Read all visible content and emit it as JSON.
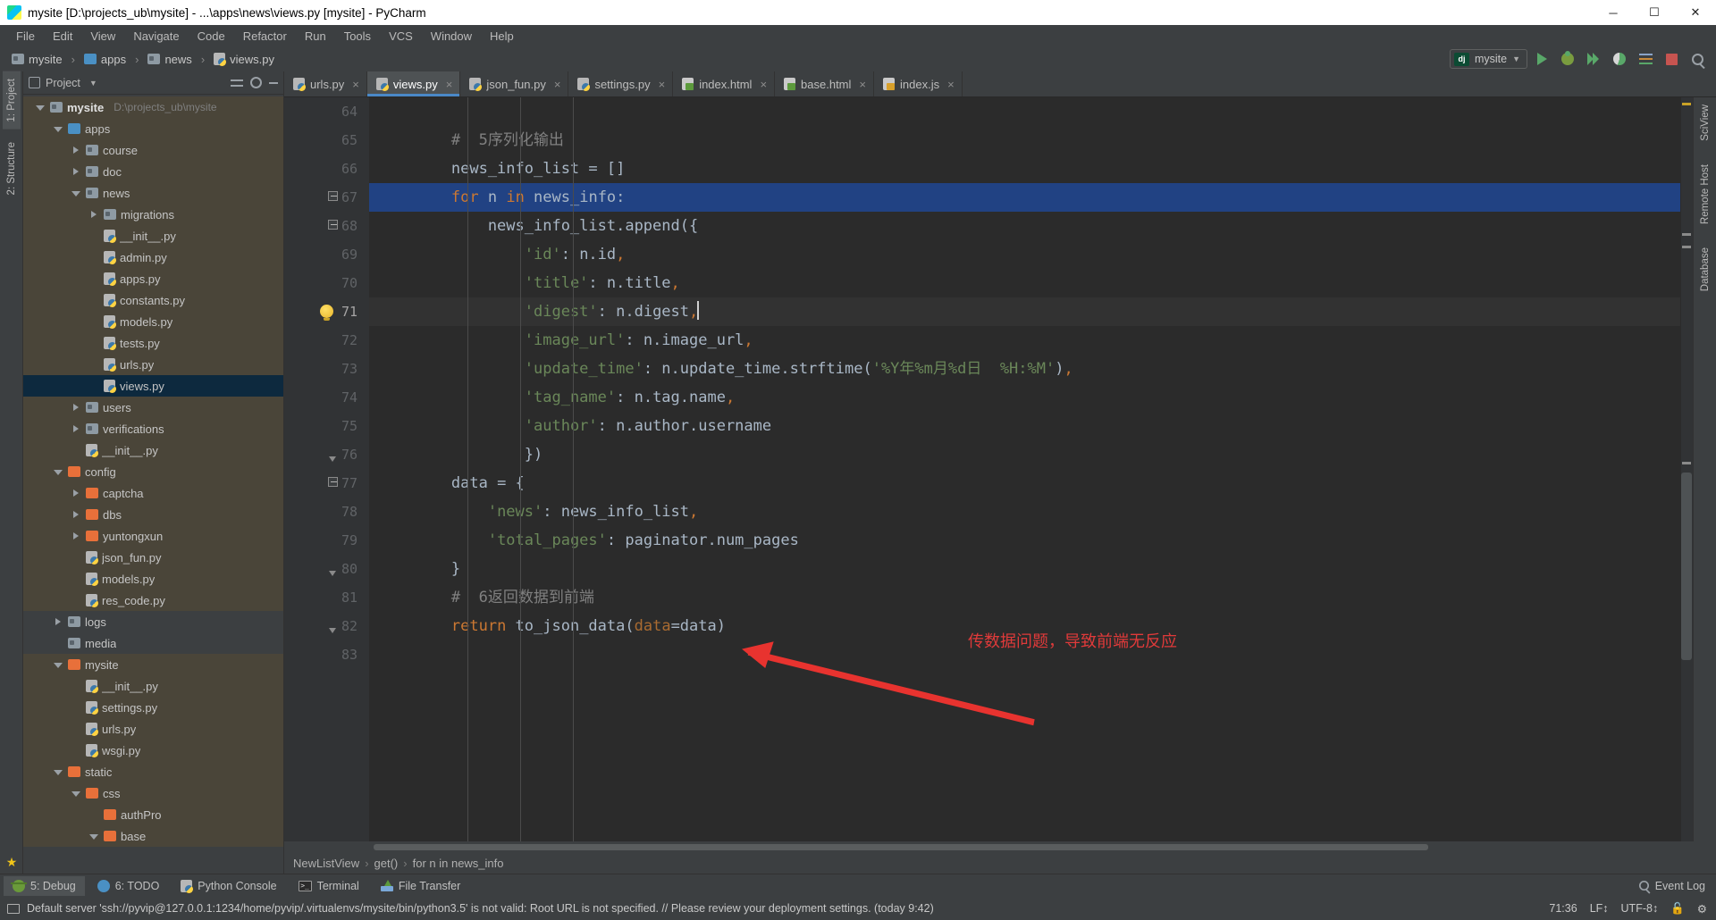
{
  "window": {
    "title": "mysite [D:\\projects_ub\\mysite] - ...\\apps\\news\\views.py [mysite] - PyCharm",
    "logo_text": "PC",
    "minimize": "─",
    "maximize": "☐",
    "close": "✕"
  },
  "menubar": {
    "items": [
      "File",
      "Edit",
      "View",
      "Navigate",
      "Code",
      "Refactor",
      "Run",
      "Tools",
      "VCS",
      "Window",
      "Help"
    ]
  },
  "navbar": {
    "breadcrumbs": [
      {
        "label": "mysite",
        "icon": "folder-icon"
      },
      {
        "label": "apps",
        "icon": "folder-blue-icon"
      },
      {
        "label": "news",
        "icon": "folder-icon"
      },
      {
        "label": "views.py",
        "icon": "python-file-icon"
      }
    ],
    "run_config": "mysite",
    "run_config_badge": "dj",
    "buttons": [
      {
        "name": "run-button",
        "title": "Run"
      },
      {
        "name": "debug-button",
        "title": "Debug"
      },
      {
        "name": "run-with-coverage-button",
        "title": "Run with Coverage"
      },
      {
        "name": "profile-button",
        "title": "Profile"
      },
      {
        "name": "attach-button",
        "title": "Attach"
      },
      {
        "name": "stop-button",
        "title": "Stop"
      },
      {
        "name": "search-everywhere-button",
        "title": "Search Everywhere"
      }
    ]
  },
  "left_rail": {
    "tabs": [
      "1: Project",
      "2: Structure"
    ],
    "active": "1: Project",
    "favorites": "2: Favorites"
  },
  "right_rail": {
    "tabs": [
      "SciView",
      "Remote Host",
      "Database"
    ]
  },
  "project_pane": {
    "title": "Project",
    "tree": [
      {
        "depth": 0,
        "label": "mysite",
        "path": "D:\\projects_ub\\mysite",
        "arrow": "open",
        "icon": "folder-icon",
        "bold": true,
        "style": "module"
      },
      {
        "depth": 1,
        "label": "apps",
        "arrow": "open",
        "icon": "folder-blue-icon",
        "style": "module"
      },
      {
        "depth": 2,
        "label": "course",
        "arrow": "closed",
        "icon": "folder-icon",
        "style": "module"
      },
      {
        "depth": 2,
        "label": "doc",
        "arrow": "closed",
        "icon": "folder-icon",
        "style": "module"
      },
      {
        "depth": 2,
        "label": "news",
        "arrow": "open",
        "icon": "folder-icon",
        "style": "module"
      },
      {
        "depth": 3,
        "label": "migrations",
        "arrow": "closed",
        "icon": "folder-icon",
        "style": "module"
      },
      {
        "depth": 3,
        "label": "__init__.py",
        "arrow": "none",
        "icon": "python-file-icon",
        "style": "module"
      },
      {
        "depth": 3,
        "label": "admin.py",
        "arrow": "none",
        "icon": "python-file-icon",
        "style": "module"
      },
      {
        "depth": 3,
        "label": "apps.py",
        "arrow": "none",
        "icon": "python-file-icon",
        "style": "module"
      },
      {
        "depth": 3,
        "label": "constants.py",
        "arrow": "none",
        "icon": "python-file-icon",
        "style": "module"
      },
      {
        "depth": 3,
        "label": "models.py",
        "arrow": "none",
        "icon": "python-file-icon",
        "style": "module"
      },
      {
        "depth": 3,
        "label": "tests.py",
        "arrow": "none",
        "icon": "python-file-icon",
        "style": "module"
      },
      {
        "depth": 3,
        "label": "urls.py",
        "arrow": "none",
        "icon": "python-file-icon",
        "style": "module"
      },
      {
        "depth": 3,
        "label": "views.py",
        "arrow": "none",
        "icon": "python-file-icon",
        "selected": true
      },
      {
        "depth": 2,
        "label": "users",
        "arrow": "closed",
        "icon": "folder-icon",
        "style": "module"
      },
      {
        "depth": 2,
        "label": "verifications",
        "arrow": "closed",
        "icon": "folder-icon",
        "style": "module"
      },
      {
        "depth": 2,
        "label": "__init__.py",
        "arrow": "none",
        "icon": "python-file-icon",
        "style": "module"
      },
      {
        "depth": 1,
        "label": "config",
        "arrow": "open",
        "icon": "folder-orange-icon",
        "style": "module"
      },
      {
        "depth": 2,
        "label": "captcha",
        "arrow": "closed",
        "icon": "folder-orange-icon",
        "style": "module"
      },
      {
        "depth": 2,
        "label": "dbs",
        "arrow": "closed",
        "icon": "folder-orange-icon",
        "style": "module"
      },
      {
        "depth": 2,
        "label": "yuntongxun",
        "arrow": "closed",
        "icon": "folder-orange-icon",
        "style": "module"
      },
      {
        "depth": 2,
        "label": "json_fun.py",
        "arrow": "none",
        "icon": "python-file-icon",
        "style": "module"
      },
      {
        "depth": 2,
        "label": "models.py",
        "arrow": "none",
        "icon": "python-file-icon",
        "style": "module"
      },
      {
        "depth": 2,
        "label": "res_code.py",
        "arrow": "none",
        "icon": "python-file-icon",
        "style": "module"
      },
      {
        "depth": 1,
        "label": "logs",
        "arrow": "closed",
        "icon": "folder-icon"
      },
      {
        "depth": 1,
        "label": "media",
        "arrow": "none",
        "icon": "folder-icon"
      },
      {
        "depth": 1,
        "label": "mysite",
        "arrow": "open",
        "icon": "folder-orange-icon",
        "style": "module"
      },
      {
        "depth": 2,
        "label": "__init__.py",
        "arrow": "none",
        "icon": "python-file-icon",
        "style": "module"
      },
      {
        "depth": 2,
        "label": "settings.py",
        "arrow": "none",
        "icon": "python-file-icon",
        "style": "module"
      },
      {
        "depth": 2,
        "label": "urls.py",
        "arrow": "none",
        "icon": "python-file-icon",
        "style": "module"
      },
      {
        "depth": 2,
        "label": "wsgi.py",
        "arrow": "none",
        "icon": "python-file-icon",
        "style": "module"
      },
      {
        "depth": 1,
        "label": "static",
        "arrow": "open",
        "icon": "folder-orange-icon",
        "style": "module"
      },
      {
        "depth": 2,
        "label": "css",
        "arrow": "open",
        "icon": "folder-orange-icon",
        "style": "module"
      },
      {
        "depth": 3,
        "label": "authPro",
        "arrow": "none",
        "icon": "folder-orange-icon",
        "style": "module"
      },
      {
        "depth": 3,
        "label": "base",
        "arrow": "open",
        "icon": "folder-orange-icon",
        "style": "module"
      }
    ]
  },
  "editor_tabs": [
    {
      "label": "urls.py",
      "icon": "python-file-icon",
      "active": false
    },
    {
      "label": "views.py",
      "icon": "python-file-icon",
      "active": true
    },
    {
      "label": "json_fun.py",
      "icon": "python-file-icon",
      "active": false
    },
    {
      "label": "settings.py",
      "icon": "python-file-icon",
      "active": false
    },
    {
      "label": "index.html",
      "icon": "html-file-icon",
      "active": false
    },
    {
      "label": "base.html",
      "icon": "html-file-icon",
      "active": false
    },
    {
      "label": "index.js",
      "icon": "js-file-icon",
      "active": false
    }
  ],
  "editor": {
    "first_line": 64,
    "lines": [
      {
        "n": 64,
        "tokens": []
      },
      {
        "n": 65,
        "tokens": [
          {
            "t": "        ",
            "c": "pun"
          },
          {
            "t": "#  5序列化输出",
            "c": "cmt"
          }
        ]
      },
      {
        "n": 66,
        "tokens": [
          {
            "t": "        news_info_list ",
            "c": "pun"
          },
          {
            "t": "= ",
            "c": "pun"
          },
          {
            "t": "[]",
            "c": "pun"
          }
        ]
      },
      {
        "n": 67,
        "highlight": true,
        "tokens": [
          {
            "t": "        ",
            "c": "pun"
          },
          {
            "t": "for ",
            "c": "kw"
          },
          {
            "t": "n ",
            "c": "pun"
          },
          {
            "t": "in ",
            "c": "kw"
          },
          {
            "t": "news_info:",
            "c": "pun"
          }
        ]
      },
      {
        "n": 68,
        "tokens": [
          {
            "t": "            news_info_list.append({",
            "c": "pun"
          }
        ]
      },
      {
        "n": 69,
        "tokens": [
          {
            "t": "                ",
            "c": "pun"
          },
          {
            "t": "'id'",
            "c": "str"
          },
          {
            "t": ": n.id",
            "c": "pun"
          },
          {
            "t": ",",
            "c": "comma"
          }
        ]
      },
      {
        "n": 70,
        "tokens": [
          {
            "t": "                ",
            "c": "pun"
          },
          {
            "t": "'title'",
            "c": "str"
          },
          {
            "t": ": n.title",
            "c": "pun"
          },
          {
            "t": ",",
            "c": "comma"
          }
        ]
      },
      {
        "n": 71,
        "caretline": true,
        "bulb": true,
        "caret": true,
        "tokens": [
          {
            "t": "                ",
            "c": "pun"
          },
          {
            "t": "'digest'",
            "c": "str"
          },
          {
            "t": ": n.digest",
            "c": "pun"
          },
          {
            "t": ",",
            "c": "comma"
          }
        ]
      },
      {
        "n": 72,
        "tokens": [
          {
            "t": "                ",
            "c": "pun"
          },
          {
            "t": "'image_url'",
            "c": "str"
          },
          {
            "t": ": n.image_url",
            "c": "pun"
          },
          {
            "t": ",",
            "c": "comma"
          }
        ]
      },
      {
        "n": 73,
        "tokens": [
          {
            "t": "                ",
            "c": "pun"
          },
          {
            "t": "'update_time'",
            "c": "str"
          },
          {
            "t": ": n.update_time.strftime(",
            "c": "pun"
          },
          {
            "t": "'%Y年%m月%d日  %H:%M'",
            "c": "str"
          },
          {
            "t": ")",
            "c": "pun"
          },
          {
            "t": ",",
            "c": "comma"
          }
        ]
      },
      {
        "n": 74,
        "tokens": [
          {
            "t": "                ",
            "c": "pun"
          },
          {
            "t": "'tag_name'",
            "c": "str"
          },
          {
            "t": ": n.tag.name",
            "c": "pun"
          },
          {
            "t": ",",
            "c": "comma"
          }
        ]
      },
      {
        "n": 75,
        "tokens": [
          {
            "t": "                ",
            "c": "pun"
          },
          {
            "t": "'author'",
            "c": "str"
          },
          {
            "t": ": n.author.username",
            "c": "pun"
          }
        ]
      },
      {
        "n": 76,
        "tokens": [
          {
            "t": "                })",
            "c": "pun"
          }
        ]
      },
      {
        "n": 77,
        "tokens": [
          {
            "t": "        data ",
            "c": "pun"
          },
          {
            "t": "= {",
            "c": "pun"
          }
        ]
      },
      {
        "n": 78,
        "tokens": [
          {
            "t": "            ",
            "c": "pun"
          },
          {
            "t": "'news'",
            "c": "str"
          },
          {
            "t": ": news_info_list",
            "c": "pun"
          },
          {
            "t": ",",
            "c": "comma"
          }
        ]
      },
      {
        "n": 79,
        "tokens": [
          {
            "t": "            ",
            "c": "pun"
          },
          {
            "t": "'total_pages'",
            "c": "str"
          },
          {
            "t": ": paginator.num_pages",
            "c": "pun"
          }
        ]
      },
      {
        "n": 80,
        "tokens": [
          {
            "t": "        }",
            "c": "pun"
          }
        ]
      },
      {
        "n": 81,
        "tokens": [
          {
            "t": "        ",
            "c": "pun"
          },
          {
            "t": "#  6返回数据到前端",
            "c": "cmt"
          }
        ]
      },
      {
        "n": 82,
        "tokens": [
          {
            "t": "        ",
            "c": "pun"
          },
          {
            "t": "return ",
            "c": "kw"
          },
          {
            "t": "to_json_data(",
            "c": "pun"
          },
          {
            "t": "data",
            "c": "param"
          },
          {
            "t": "=data)",
            "c": "pun"
          }
        ]
      },
      {
        "n": 83,
        "tokens": []
      }
    ]
  },
  "annotation": {
    "text": "传数据问题，导致前端无反应",
    "color": "#e03a3a"
  },
  "breadcrumb_bar": {
    "parts": [
      "NewListView",
      "get()",
      "for n in news_info"
    ]
  },
  "bottom_bar": {
    "tools": [
      {
        "label": "5: Debug",
        "mnemonic": "5",
        "icon": "debug-icon",
        "active": true
      },
      {
        "label": "6: TODO",
        "mnemonic": "6",
        "icon": "todo-icon",
        "active": false
      },
      {
        "label": "Python Console",
        "icon": "python-console-icon",
        "active": false
      },
      {
        "label": "Terminal",
        "icon": "terminal-icon",
        "active": false
      },
      {
        "label": "File Transfer",
        "icon": "file-transfer-icon",
        "active": false
      }
    ],
    "event_log": "Event Log"
  },
  "status_bar": {
    "message": "Default server 'ssh://pyvip@127.0.0.1:1234/home/pyvip/.virtualenvs/mysite/bin/python3.5' is not valid: Root URL is not specified. // Please review your deployment settings. (today 9:42)",
    "caret_position": "71:36",
    "line_separator": "LF",
    "encoding": "UTF-8",
    "lock_icon": "unlocked-icon",
    "inspection_icon": "inspections-icon"
  }
}
